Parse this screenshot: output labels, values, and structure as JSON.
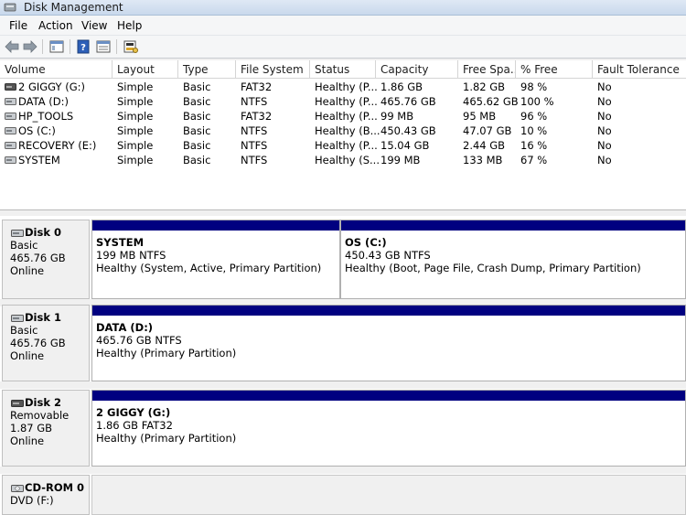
{
  "window": {
    "title": "Disk Management"
  },
  "menu": {
    "file": "File",
    "action": "Action",
    "view": "View",
    "help": "Help"
  },
  "toolbar": {
    "icons": [
      "back-arrow-icon",
      "forward-arrow-icon",
      "show-hide-console-tree-icon",
      "help-icon",
      "properties-icon",
      "disk-settings-icon"
    ]
  },
  "volume_list": {
    "columns": [
      "Volume",
      "Layout",
      "Type",
      "File System",
      "Status",
      "Capacity",
      "Free Spa...",
      "% Free",
      "Fault Tolerance"
    ],
    "rows": [
      {
        "volume": "2 GIGGY (G:)",
        "layout": "Simple",
        "type": "Basic",
        "fs": "FAT32",
        "status": "Healthy (P...",
        "capacity": "1.86 GB",
        "free": "1.82 GB",
        "pct": "98 %",
        "fault": "No"
      },
      {
        "volume": "DATA (D:)",
        "layout": "Simple",
        "type": "Basic",
        "fs": "NTFS",
        "status": "Healthy (P...",
        "capacity": "465.76 GB",
        "free": "465.62 GB",
        "pct": "100 %",
        "fault": "No"
      },
      {
        "volume": "HP_TOOLS",
        "layout": "Simple",
        "type": "Basic",
        "fs": "FAT32",
        "status": "Healthy (P...",
        "capacity": "99 MB",
        "free": "95 MB",
        "pct": "96 %",
        "fault": "No"
      },
      {
        "volume": "OS (C:)",
        "layout": "Simple",
        "type": "Basic",
        "fs": "NTFS",
        "status": "Healthy (B...",
        "capacity": "450.43 GB",
        "free": "47.07 GB",
        "pct": "10 %",
        "fault": "No"
      },
      {
        "volume": "RECOVERY (E:)",
        "layout": "Simple",
        "type": "Basic",
        "fs": "NTFS",
        "status": "Healthy (P...",
        "capacity": "15.04 GB",
        "free": "2.44 GB",
        "pct": "16 %",
        "fault": "No"
      },
      {
        "volume": "SYSTEM",
        "layout": "Simple",
        "type": "Basic",
        "fs": "NTFS",
        "status": "Healthy (S...",
        "capacity": "199 MB",
        "free": "133 MB",
        "pct": "67 %",
        "fault": "No"
      }
    ]
  },
  "disks": [
    {
      "name": "Disk 0",
      "kind": "Basic",
      "size": "465.76 GB",
      "state": "Online",
      "partitions": [
        {
          "title": "SYSTEM",
          "fs": "199 MB NTFS",
          "status": "Healthy (System, Active, Primary Partition)"
        },
        {
          "title": "OS  (C:)",
          "fs": "450.43 GB NTFS",
          "status": "Healthy (Boot, Page File, Crash Dump, Primary Partition)"
        }
      ]
    },
    {
      "name": "Disk 1",
      "kind": "Basic",
      "size": "465.76 GB",
      "state": "Online",
      "partitions": [
        {
          "title": "DATA  (D:)",
          "fs": "465.76 GB NTFS",
          "status": "Healthy (Primary Partition)"
        }
      ]
    },
    {
      "name": "Disk 2",
      "kind": "Removable",
      "size": "1.87 GB",
      "state": "Online",
      "partitions": [
        {
          "title": "2 GIGGY  (G:)",
          "fs": "1.86 GB FAT32",
          "status": "Healthy (Primary Partition)"
        }
      ]
    },
    {
      "name": "CD-ROM 0",
      "kind": "DVD (F:)"
    }
  ],
  "colors": {
    "partition_bar": "#000080",
    "panel_bg": "#f0f0f0"
  }
}
